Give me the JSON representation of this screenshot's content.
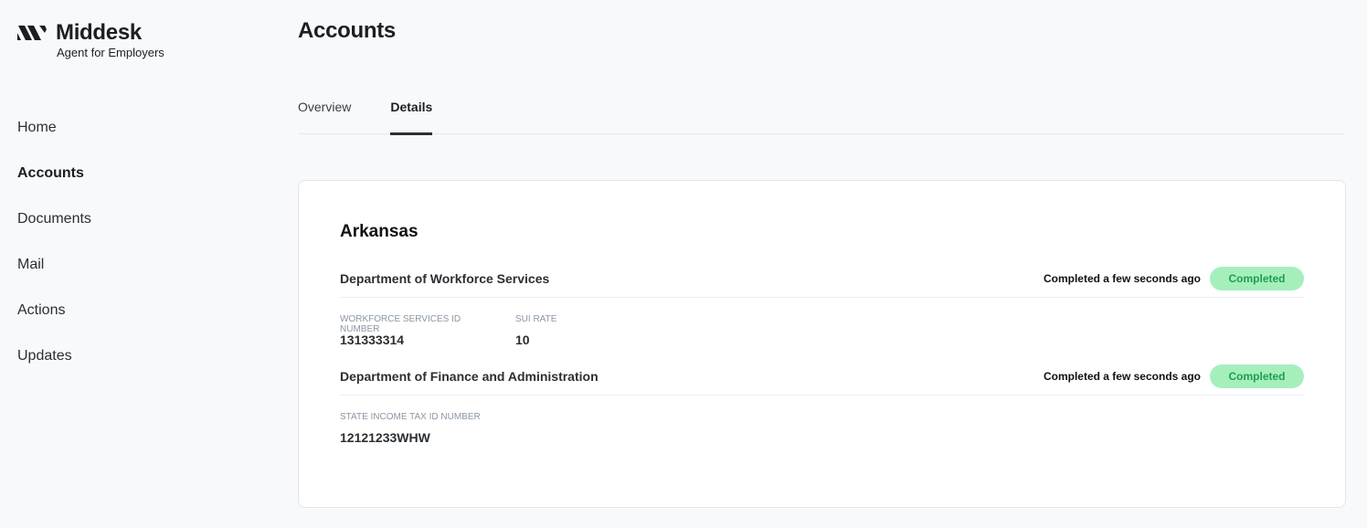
{
  "brand": {
    "name": "Middesk",
    "subtitle": "Agent for Employers"
  },
  "nav": {
    "items": [
      {
        "label": "Home",
        "active": false
      },
      {
        "label": "Accounts",
        "active": true
      },
      {
        "label": "Documents",
        "active": false
      },
      {
        "label": "Mail",
        "active": false
      },
      {
        "label": "Actions",
        "active": false
      },
      {
        "label": "Updates",
        "active": false
      }
    ]
  },
  "page": {
    "title": "Accounts",
    "tabs": [
      {
        "label": "Overview",
        "active": false
      },
      {
        "label": "Details",
        "active": true
      }
    ]
  },
  "card": {
    "state": "Arkansas",
    "agencies": [
      {
        "name": "Department of Workforce Services",
        "status_text": "Completed a few seconds ago",
        "badge": "Completed",
        "fields": [
          {
            "label": "WORKFORCE SERVICES ID NUMBER",
            "value": "131333314"
          },
          {
            "label": "SUI RATE",
            "value": "10"
          }
        ]
      },
      {
        "name": "Department of Finance and Administration",
        "status_text": "Completed a few seconds ago",
        "badge": "Completed",
        "fields": [
          {
            "label": "STATE INCOME TAX ID NUMBER",
            "value": "12121233WHW"
          }
        ]
      }
    ]
  },
  "colors": {
    "background": "#f8f9fa",
    "badge_bg": "#a5efbd",
    "badge_text": "#1f9d4f",
    "field_label": "#8a96a3"
  },
  "icons": {
    "logo": "middesk-logo-icon"
  }
}
